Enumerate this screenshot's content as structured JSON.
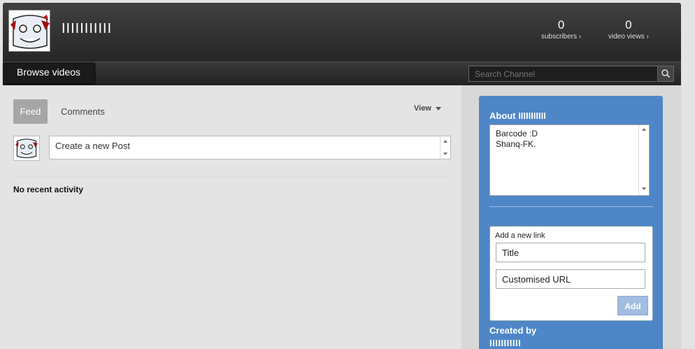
{
  "header": {
    "channel_name": "IIIIIIIIIII",
    "stats": [
      {
        "value": "0",
        "label": "subscribers ›"
      },
      {
        "value": "0",
        "label": "video views ›"
      }
    ]
  },
  "nav": {
    "browse_label": "Browse videos",
    "search_placeholder": "Search Channel",
    "search_icon": "search-icon"
  },
  "feed": {
    "tabs": [
      "Feed",
      "Comments"
    ],
    "view_label": "View",
    "post_placeholder": "Create a new Post",
    "empty_text": "No recent activity"
  },
  "about": {
    "title": "About IIIIIIIIIII",
    "lines": [
      "Barcode :D",
      "Shanq-FK."
    ],
    "add_link_label": "Add a new link",
    "title_placeholder": "Title",
    "url_placeholder": "Customised URL",
    "add_button": "Add",
    "created_by_label": "Created by",
    "created_by_name": "IIIIIIIIIII"
  },
  "colors": {
    "panel_blue": "#4e86c8",
    "header_dark": "#262626"
  }
}
